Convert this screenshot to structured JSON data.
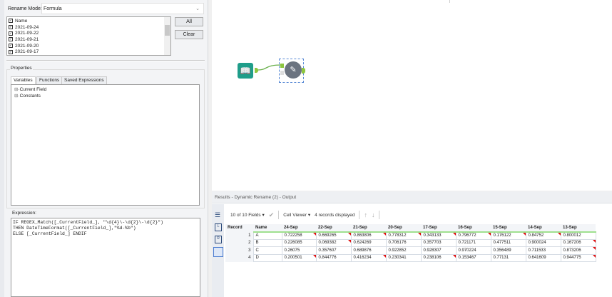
{
  "config": {
    "rename_mode_label": "Rename Mode:",
    "rename_mode_value": "Formula",
    "fields": [
      "Name",
      "2021-09-24",
      "2021-09-22",
      "2021-09-21",
      "2021-09-20",
      "2021-09-17"
    ],
    "all_button": "All",
    "clear_button": "Clear",
    "properties_label": "Properties",
    "tabs": [
      "Variables",
      "Functions",
      "Saved Expressions"
    ],
    "tree": [
      "Current Field",
      "Constants"
    ],
    "expression_label": "Expression:",
    "expression": "IF REGEX_Match([_CurrentField_], \"\\d{4}\\-\\d{2}\\-\\d{2}\")\nTHEN DateTimeFormat([_CurrentField_],\"%d-%b\")\nELSE [_CurrentField_] ENDIF"
  },
  "results": {
    "title": "Results - Dynamic Rename (2) - Output",
    "fields_selector": "10 of 10 Fields",
    "cell_viewer": "Cell Viewer",
    "records_displayed": "4 records displayed",
    "columns": [
      "Record",
      "Name",
      "24-Sep",
      "22-Sep",
      "21-Sep",
      "20-Sep",
      "17-Sep",
      "16-Sep",
      "15-Sep",
      "14-Sep",
      "13-Sep"
    ],
    "rows": [
      [
        "1",
        "A",
        "0.722258",
        "0.669265",
        "0.863806",
        "0.778312",
        "0.343133",
        "0.796772",
        "0.176122",
        "0.84752",
        "0.800012"
      ],
      [
        "2",
        "B",
        "0.226085",
        "0.069382",
        "0.624269",
        "0.706176",
        "0.357703",
        "0.721171",
        "0.477511",
        "0.900024",
        "0.167206"
      ],
      [
        "3",
        "C",
        "0.26075",
        "0.357607",
        "0.689876",
        "0.922852",
        "0.928307",
        "0.970224",
        "0.356489",
        "0.711533",
        "0.873206"
      ],
      [
        "4",
        "D",
        "0.200501",
        "0.844776",
        "0.416234",
        "0.230341",
        "0.238106",
        "0.153467",
        "0.77131",
        "0.641609",
        "0.944775"
      ]
    ]
  }
}
